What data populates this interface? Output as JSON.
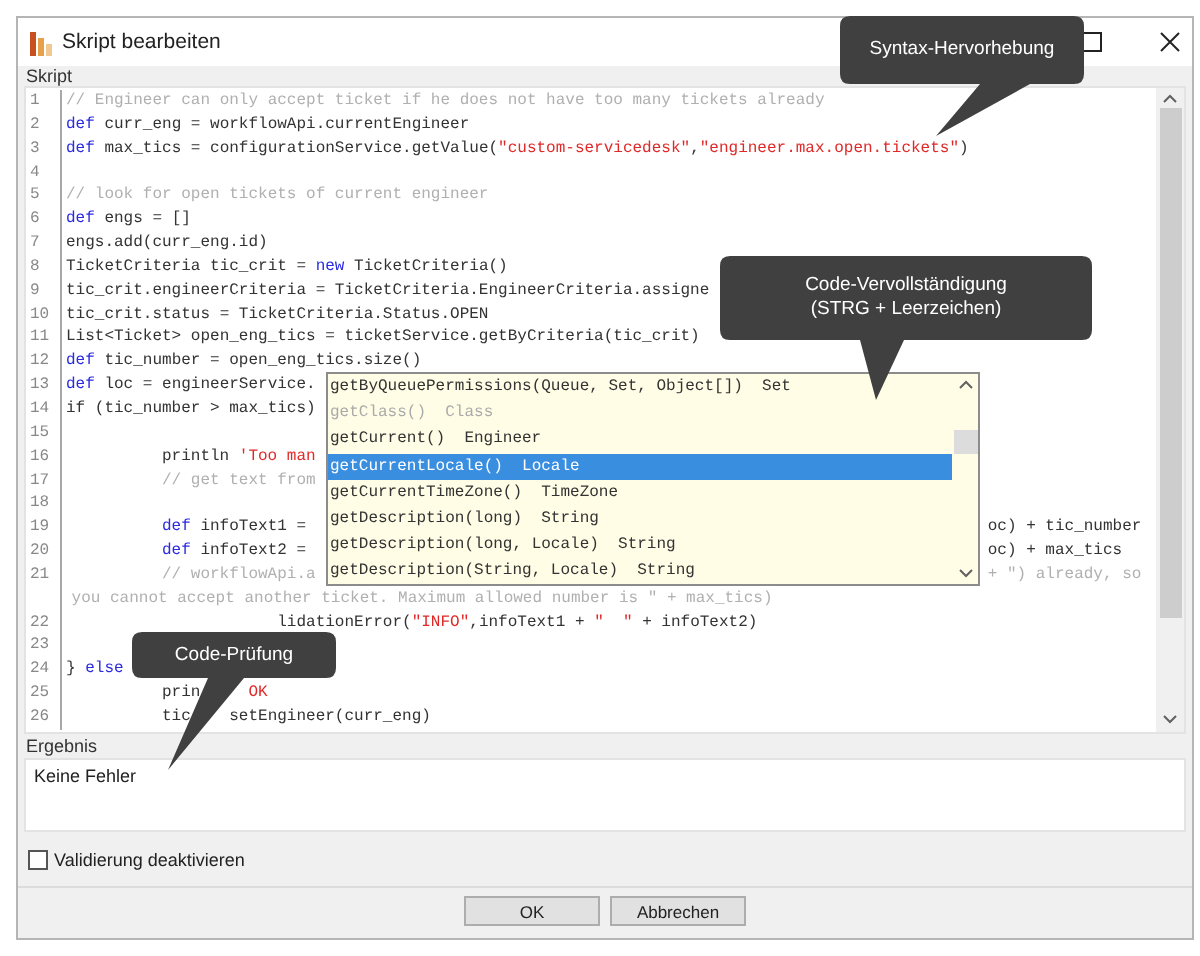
{
  "window": {
    "title": "Skript bearbeiten"
  },
  "script_section": {
    "label": "Skript"
  },
  "editor": {
    "lines": [
      {
        "number": "1",
        "segments": [
          {
            "text": "// Engineer can only accept ticket if he does not have too many tickets already",
            "kind": "comment"
          }
        ]
      },
      {
        "number": "2",
        "segments": [
          {
            "text": "def",
            "kind": "keyword"
          },
          {
            "text": " curr_eng = workflowApi.currentEngineer",
            "kind": "plain"
          }
        ]
      },
      {
        "number": "3",
        "segments": [
          {
            "text": "def",
            "kind": "keyword"
          },
          {
            "text": " max_tics = configurationService.getValue(",
            "kind": "plain"
          },
          {
            "text": "\"custom-servicedesk\"",
            "kind": "string"
          },
          {
            "text": ",",
            "kind": "plain"
          },
          {
            "text": "\"engineer.max.open.tickets\"",
            "kind": "string"
          },
          {
            "text": ")",
            "kind": "plain"
          }
        ]
      },
      {
        "number": "4"
      },
      {
        "number": "5",
        "segments": [
          {
            "text": "// look for open tickets of current engineer",
            "kind": "comment"
          }
        ]
      },
      {
        "number": "6",
        "segments": [
          {
            "text": "def",
            "kind": "keyword"
          },
          {
            "text": " engs = []",
            "kind": "plain"
          }
        ]
      },
      {
        "number": "7",
        "segments": [
          {
            "text": "engs.add(curr_eng.id)",
            "kind": "plain"
          }
        ]
      },
      {
        "number": "8",
        "segments": [
          {
            "text": "TicketCriteria tic_crit = ",
            "kind": "plain"
          },
          {
            "text": "new",
            "kind": "keyword"
          },
          {
            "text": " TicketCriteria()",
            "kind": "plain"
          }
        ]
      },
      {
        "number": "9",
        "segments": [
          {
            "text": "tic_crit.engineerCriteria = TicketCriteria.EngineerCriteria.assigne",
            "kind": "plain"
          }
        ]
      },
      {
        "number": "10",
        "segments": [
          {
            "text": "tic_crit.status = TicketCriteria.Status.OPEN",
            "kind": "plain"
          }
        ]
      },
      {
        "number": "11",
        "segments": [
          {
            "text": "List<Ticket> open_eng_tics = ticketService.getByCriteria(tic_crit)",
            "kind": "plain"
          }
        ]
      },
      {
        "number": "12",
        "segments": [
          {
            "text": "def",
            "kind": "keyword"
          },
          {
            "text": " tic_number = open_eng_tics.size()",
            "kind": "plain"
          }
        ]
      },
      {
        "number": "13",
        "segments": [
          {
            "text": "def",
            "kind": "keyword"
          },
          {
            "text": " loc = engineerService.",
            "kind": "plain"
          }
        ]
      },
      {
        "number": "14",
        "segments": [
          {
            "text": "if (tic_number > max_tics)",
            "kind": "plain"
          }
        ]
      },
      {
        "number": "15"
      },
      {
        "number": "16",
        "indented": true,
        "segments": [
          {
            "text": "println ",
            "kind": "plain"
          },
          {
            "text": "'Too man",
            "kind": "string"
          }
        ]
      },
      {
        "number": "17",
        "indented": true,
        "segments": [
          {
            "text": "// get text from",
            "kind": "comment"
          }
        ]
      },
      {
        "number": "18"
      },
      {
        "number": "19",
        "indented": true,
        "segments": [
          {
            "text": "def",
            "kind": "keyword"
          },
          {
            "text": " infoText1 = ",
            "kind": "plain"
          }
        ],
        "tail": [
          {
            "text": "oc) + tic_number",
            "kind": "plain"
          }
        ]
      },
      {
        "number": "20",
        "indented": true,
        "segments": [
          {
            "text": "def",
            "kind": "keyword"
          },
          {
            "text": " infoText2 = ",
            "kind": "plain"
          }
        ],
        "tail": [
          {
            "text": "oc) + max_tics",
            "kind": "plain"
          }
        ]
      },
      {
        "number": "21",
        "indented": true,
        "segments": [
          {
            "text": "// workflowApi.a",
            "kind": "comment"
          }
        ],
        "tail": [
          {
            "text": "+ \") already, so",
            "kind": "comment"
          }
        ]
      },
      {
        "segments": [
          {
            "text": "you cannot accept another ticket. Maximum allowed number is \" + max_tics)",
            "kind": "comment"
          }
        ]
      },
      {
        "number": "22",
        "tail": [
          {
            "text": "lidationError(",
            "kind": "plain"
          },
          {
            "text": "\"INFO\"",
            "kind": "string"
          },
          {
            "text": ",infoText1 + ",
            "kind": "plain"
          },
          {
            "text": "\"  \"",
            "kind": "string"
          },
          {
            "text": " + infoText2)",
            "kind": "plain"
          }
        ]
      },
      {
        "number": "23"
      },
      {
        "number": "24",
        "segments": [
          {
            "text": "} ",
            "kind": "plain"
          },
          {
            "text": "else",
            "kind": "keyword"
          }
        ]
      },
      {
        "number": "25",
        "indented": true,
        "segments": [
          {
            "text": "prin",
            "kind": "plain"
          }
        ],
        "tail": [
          {
            "text": "OK",
            "kind": "string"
          }
        ]
      },
      {
        "number": "26",
        "indented": true,
        "segments": [
          {
            "text": "tic",
            "kind": "plain"
          }
        ],
        "tail": [
          {
            "text": "setEngineer(curr_eng)",
            "kind": "plain"
          }
        ]
      }
    ]
  },
  "autocomplete": {
    "items": [
      {
        "signature": "getByQueuePermissions(Queue, Set, Object[])",
        "type": "Set",
        "selected": false,
        "dimmed": false
      },
      {
        "signature": "getClass()",
        "type": "Class",
        "selected": false,
        "dimmed": true
      },
      {
        "signature": "getCurrent()",
        "type": "Engineer",
        "selected": false,
        "dimmed": false
      },
      {
        "signature": "getCurrentLocale()",
        "type": "Locale",
        "selected": true,
        "dimmed": false
      },
      {
        "signature": "getCurrentTimeZone()",
        "type": "TimeZone",
        "selected": false,
        "dimmed": false
      },
      {
        "signature": "getDescription(long)",
        "type": "String",
        "selected": false,
        "dimmed": false
      },
      {
        "signature": "getDescription(long, Locale)",
        "type": "String",
        "selected": false,
        "dimmed": false
      },
      {
        "signature": "getDescription(String, Locale)",
        "type": "String",
        "selected": false,
        "dimmed": false
      }
    ]
  },
  "result_section": {
    "label": "Ergebnis",
    "message": "Keine Fehler"
  },
  "disable_validation": {
    "label": "Validierung deaktivieren",
    "checked": false
  },
  "buttons": [
    {
      "label": "OK"
    },
    {
      "label": "Abbrechen"
    }
  ],
  "callouts": [
    {
      "lines": [
        "Syntax-Hervorhebung"
      ]
    },
    {
      "lines": [
        "Code-Vervollständigung",
        "(STRG + Leerzeichen)"
      ]
    },
    {
      "lines": [
        "Code-Prüfung"
      ]
    }
  ]
}
